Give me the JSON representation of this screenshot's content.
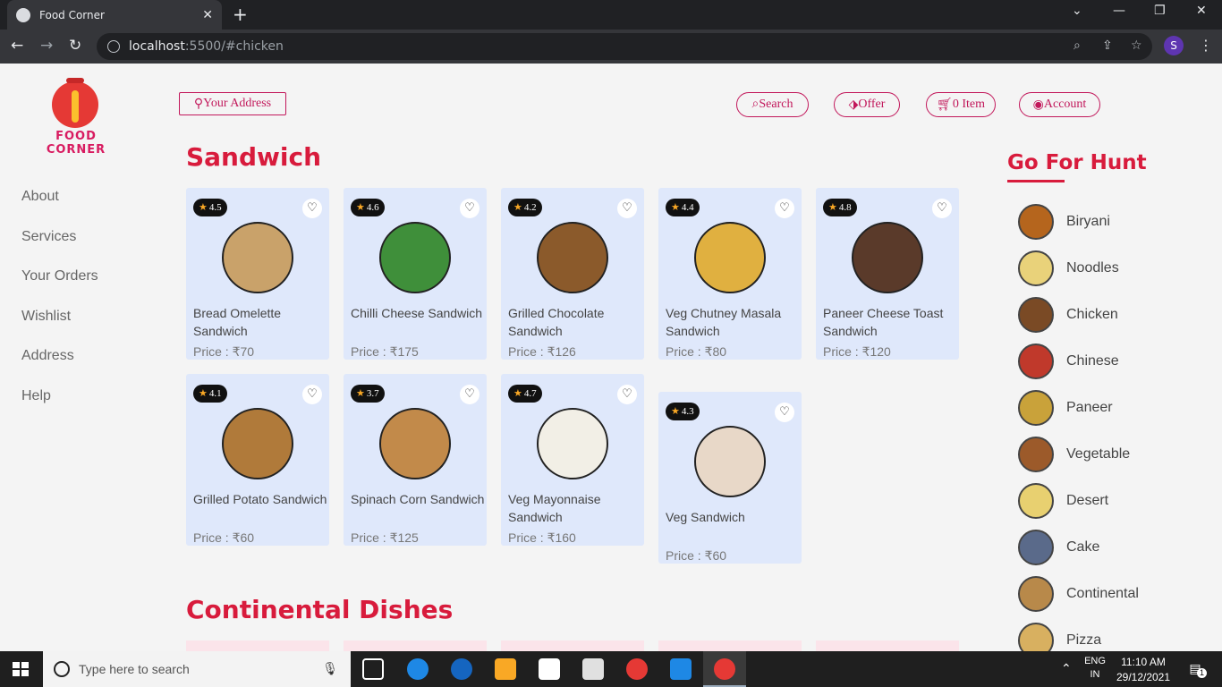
{
  "browser": {
    "tab_title": "Food Corner",
    "tab_close": "✕",
    "new_tab": "+",
    "url_host": "localhost",
    "url_path": ":5500/#chicken",
    "profile_initial": "S"
  },
  "logo": {
    "text": "FOOD CORNER"
  },
  "sidenav": {
    "items": [
      {
        "label": "About"
      },
      {
        "label": "Services"
      },
      {
        "label": "Your Orders"
      },
      {
        "label": "Wishlist"
      },
      {
        "label": "Address"
      },
      {
        "label": "Help"
      }
    ]
  },
  "header": {
    "address_label": "Your Address",
    "search_label": "Search",
    "offer_label": "Offer",
    "cart_label": "0 Item",
    "account_label": "Account"
  },
  "sandwich": {
    "title": "Sandwich",
    "items": [
      {
        "rating": "4.5",
        "name": "Bread Omelette Sandwich",
        "price": "Price : ₹70"
      },
      {
        "rating": "4.6",
        "name": "Chilli Cheese Sandwich",
        "price": "Price : ₹175"
      },
      {
        "rating": "4.2",
        "name": "Grilled Chocolate Sandwich",
        "price": "Price : ₹126"
      },
      {
        "rating": "4.4",
        "name": "Veg Chutney Masala Sandwich",
        "price": "Price : ₹80"
      },
      {
        "rating": "4.8",
        "name": "Paneer Cheese Toast Sandwich",
        "price": "Price : ₹120"
      },
      {
        "rating": "4.1",
        "name": "Grilled Potato Sandwich",
        "price": "Price : ₹60"
      },
      {
        "rating": "3.7",
        "name": "Spinach Corn Sandwich",
        "price": "Price : ₹125"
      },
      {
        "rating": "4.7",
        "name": "Veg Mayonnaise Sandwich",
        "price": "Price : ₹160"
      },
      {
        "rating": "4.3",
        "name": "Veg Sandwich",
        "price": "Price : ₹60"
      }
    ],
    "image_colors": [
      "#c9a26a",
      "#3f8f3a",
      "#8b5a2b",
      "#e0b040",
      "#5a3a2a",
      "#b07a3a",
      "#c28a4a",
      "#f2efe6",
      "#e8d8c8"
    ]
  },
  "continental": {
    "title": "Continental Dishes"
  },
  "hunt": {
    "title": "Go For Hunt",
    "items": [
      {
        "label": "Biryani",
        "color": "#b5651d"
      },
      {
        "label": "Noodles",
        "color": "#e9d27a"
      },
      {
        "label": "Chicken",
        "color": "#7a4a25"
      },
      {
        "label": "Chinese",
        "color": "#c0392b"
      },
      {
        "label": "Paneer",
        "color": "#c9a23a"
      },
      {
        "label": "Vegetable",
        "color": "#9c5a2a"
      },
      {
        "label": "Desert",
        "color": "#e8d070"
      },
      {
        "label": "Cake",
        "color": "#5a6a8a"
      },
      {
        "label": "Continental",
        "color": "#b8894a"
      },
      {
        "label": "Pizza",
        "color": "#d8b060"
      }
    ]
  },
  "taskbar": {
    "search_placeholder": "Type here to search",
    "lang_top": "ENG",
    "lang_bottom": "IN",
    "time": "11:10 AM",
    "date": "29/12/2021",
    "notif_count": "1"
  },
  "colors": {
    "accent": "#d81b3c",
    "card_bg": "#dfe8fb"
  }
}
